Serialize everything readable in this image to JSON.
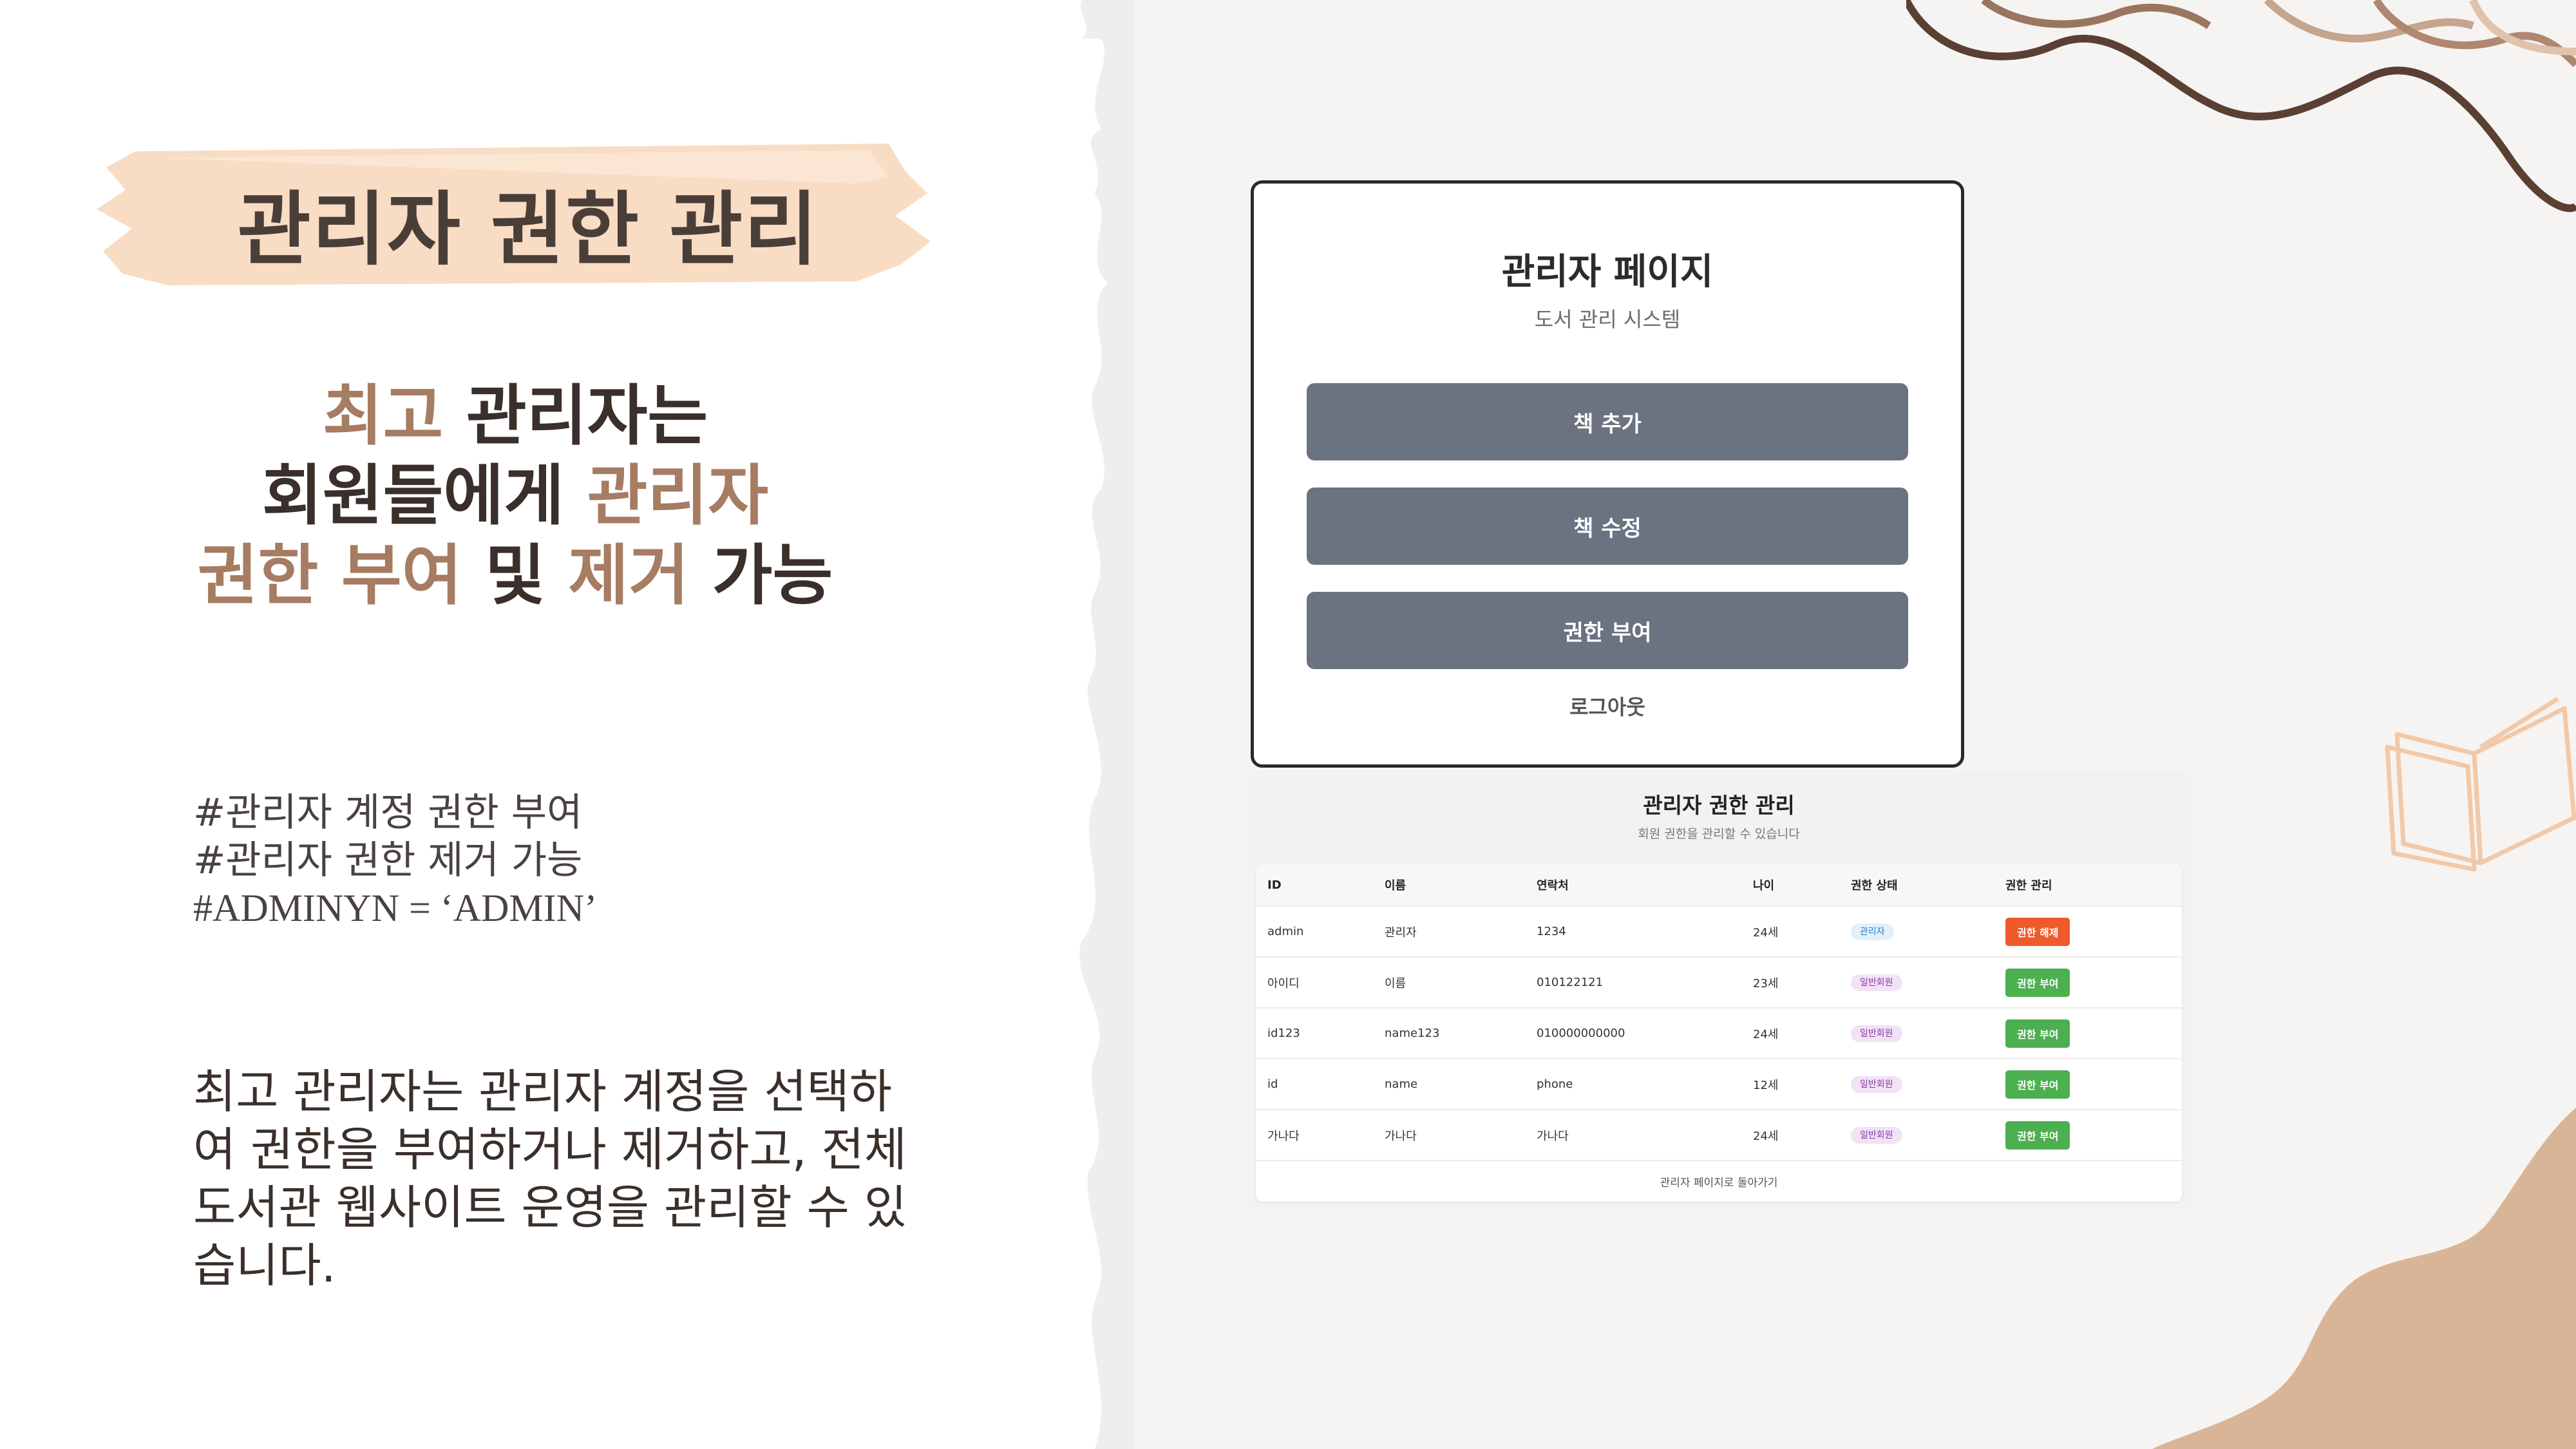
{
  "left": {
    "title": "관리자 권한 관리",
    "highlight": {
      "l1a": "최고",
      "l1b": " 관리자는",
      "l2a": "회원들에게 ",
      "l2b": "관리자",
      "l3a": "권한 부여",
      "l3b": " 및 ",
      "l3c": "제거",
      "l3d": " 가능"
    },
    "hashtags": [
      "#관리자 계정 권한 부여",
      "#관리자 권한 제거 가능",
      "#ADMINYN = ‘ADMIN’"
    ],
    "description": "최고 관리자는 관리자 계정을 선택하여 권한을 부여하거나 제거하고, 전체 도서관 웹사이트 운영을 관리할 수 있습니다."
  },
  "admin_page": {
    "title": "관리자 페이지",
    "subtitle": "도서 관리 시스템",
    "buttons": {
      "add_book": "책 추가",
      "edit_book": "책 수정",
      "grant_permission": "권한 부여"
    },
    "logout": "로그아웃"
  },
  "permission_page": {
    "title": "관리자 권한 관리",
    "subtitle": "회원 권한을 관리할 수 있습니다",
    "columns": [
      "ID",
      "이름",
      "연락처",
      "나이",
      "권한 상태",
      "권한 관리"
    ],
    "rows": [
      {
        "id": "admin",
        "name": "관리자",
        "phone": "1234",
        "age": "24세",
        "status": "관리자",
        "action": "권한 해제"
      },
      {
        "id": "아이디",
        "name": "이름",
        "phone": "010122121",
        "age": "23세",
        "status": "일반회원",
        "action": "권한 부여"
      },
      {
        "id": "id123",
        "name": "name123",
        "phone": "010000000000",
        "age": "24세",
        "status": "일반회원",
        "action": "권한 부여"
      },
      {
        "id": "id",
        "name": "name",
        "phone": "phone",
        "age": "12세",
        "status": "일반회원",
        "action": "권한 부여"
      },
      {
        "id": "가나다",
        "name": "가나다",
        "phone": "가나다",
        "age": "24세",
        "status": "일반회원",
        "action": "권한 부여"
      }
    ],
    "back_link": "관리자 페이지로 돌아가기"
  },
  "colors": {
    "accent": "#a67c62",
    "brush": "#f9dcc4",
    "button": "#6b7280",
    "remove_button": "#ee5a2a",
    "grant_button": "#4caf50"
  }
}
